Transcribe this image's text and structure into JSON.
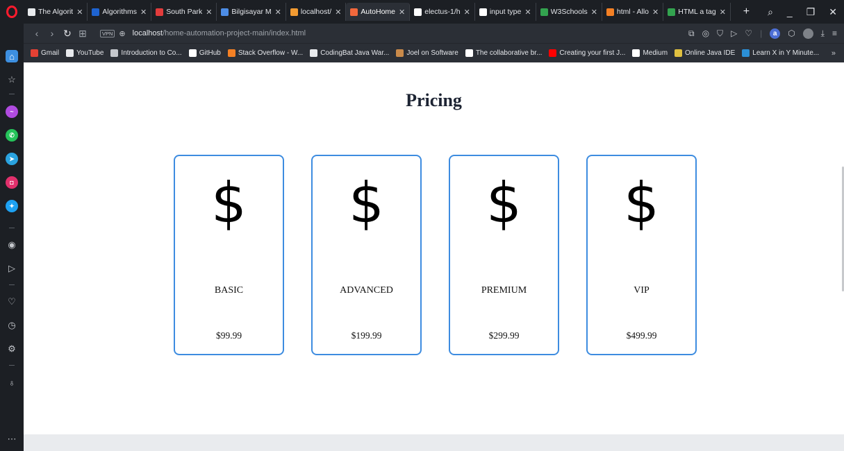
{
  "browser": {
    "tabs": [
      {
        "title": "The Algorit",
        "icon": "document-icon",
        "color": "#e8eaed",
        "active": false
      },
      {
        "title": "Algorithms",
        "icon": "c-logo-icon",
        "color": "#1e63d0",
        "active": false
      },
      {
        "title": "South Park",
        "icon": "southpark-icon",
        "color": "#e23c3c",
        "active": false
      },
      {
        "title": "Bilgisayar M",
        "icon": "site-icon",
        "color": "#4d8de6",
        "active": false
      },
      {
        "title": "localhost/",
        "icon": "xampp-icon",
        "color": "#f29b32",
        "active": false
      },
      {
        "title": "AutoHome",
        "icon": "autohome-icon",
        "color": "#f2683c",
        "active": true
      },
      {
        "title": "electus-1/h",
        "icon": "github-icon",
        "color": "#ffffff",
        "active": false
      },
      {
        "title": "input type",
        "icon": "google-icon",
        "color": "#ffffff",
        "active": false
      },
      {
        "title": "W3Schools",
        "icon": "w3schools-icon",
        "color": "#33a34f",
        "active": false
      },
      {
        "title": "html - Allo",
        "icon": "stackoverflow-icon",
        "color": "#f48024",
        "active": false
      },
      {
        "title": "HTML a tag",
        "icon": "w3schools-icon",
        "color": "#33a34f",
        "active": false
      }
    ],
    "new_tab_label": "+",
    "url_host": "localhost",
    "url_path": "/home-automation-project-main/index.html",
    "vpn_label": "VPN",
    "bookmarks": [
      {
        "label": "Gmail",
        "icon": "gmail-icon",
        "color": "#e44134"
      },
      {
        "label": "YouTube",
        "icon": "document-icon",
        "color": "#e8eaed"
      },
      {
        "label": "Introduction to Co...",
        "icon": "edx-icon",
        "color": "#c4c7cc"
      },
      {
        "label": "GitHub",
        "icon": "github-icon",
        "color": "#ffffff"
      },
      {
        "label": "Stack Overflow - W...",
        "icon": "stackoverflow-icon",
        "color": "#f48024"
      },
      {
        "label": "CodingBat Java War...",
        "icon": "document-icon",
        "color": "#e8eaed"
      },
      {
        "label": "Joel on Software",
        "icon": "joel-icon",
        "color": "#c98a4a"
      },
      {
        "label": "The collaborative br...",
        "icon": "circle-icon",
        "color": "#ffffff"
      },
      {
        "label": "Creating your first J...",
        "icon": "youtube-icon",
        "color": "#ff0000"
      },
      {
        "label": "Medium",
        "icon": "medium-icon",
        "color": "#ffffff"
      },
      {
        "label": "Online Java IDE",
        "icon": "ide-icon",
        "color": "#e0c040"
      },
      {
        "label": "Learn X in Y Minute...",
        "icon": "x-logo-icon",
        "color": "#2b8fd6"
      }
    ],
    "bookmarks_more": "»"
  },
  "page": {
    "title": "Pricing",
    "currency_symbol": "$",
    "plans": [
      {
        "name": "BASIC",
        "price": "$99.99"
      },
      {
        "name": "ADVANCED",
        "price": "$199.99"
      },
      {
        "name": "PREMIUM",
        "price": "$299.99"
      },
      {
        "name": "VIP",
        "price": "$499.99"
      }
    ]
  },
  "colors": {
    "card_border": "#3d8ce0",
    "chrome_dark": "#1c1f24",
    "chrome_mid": "#2b2f36"
  }
}
